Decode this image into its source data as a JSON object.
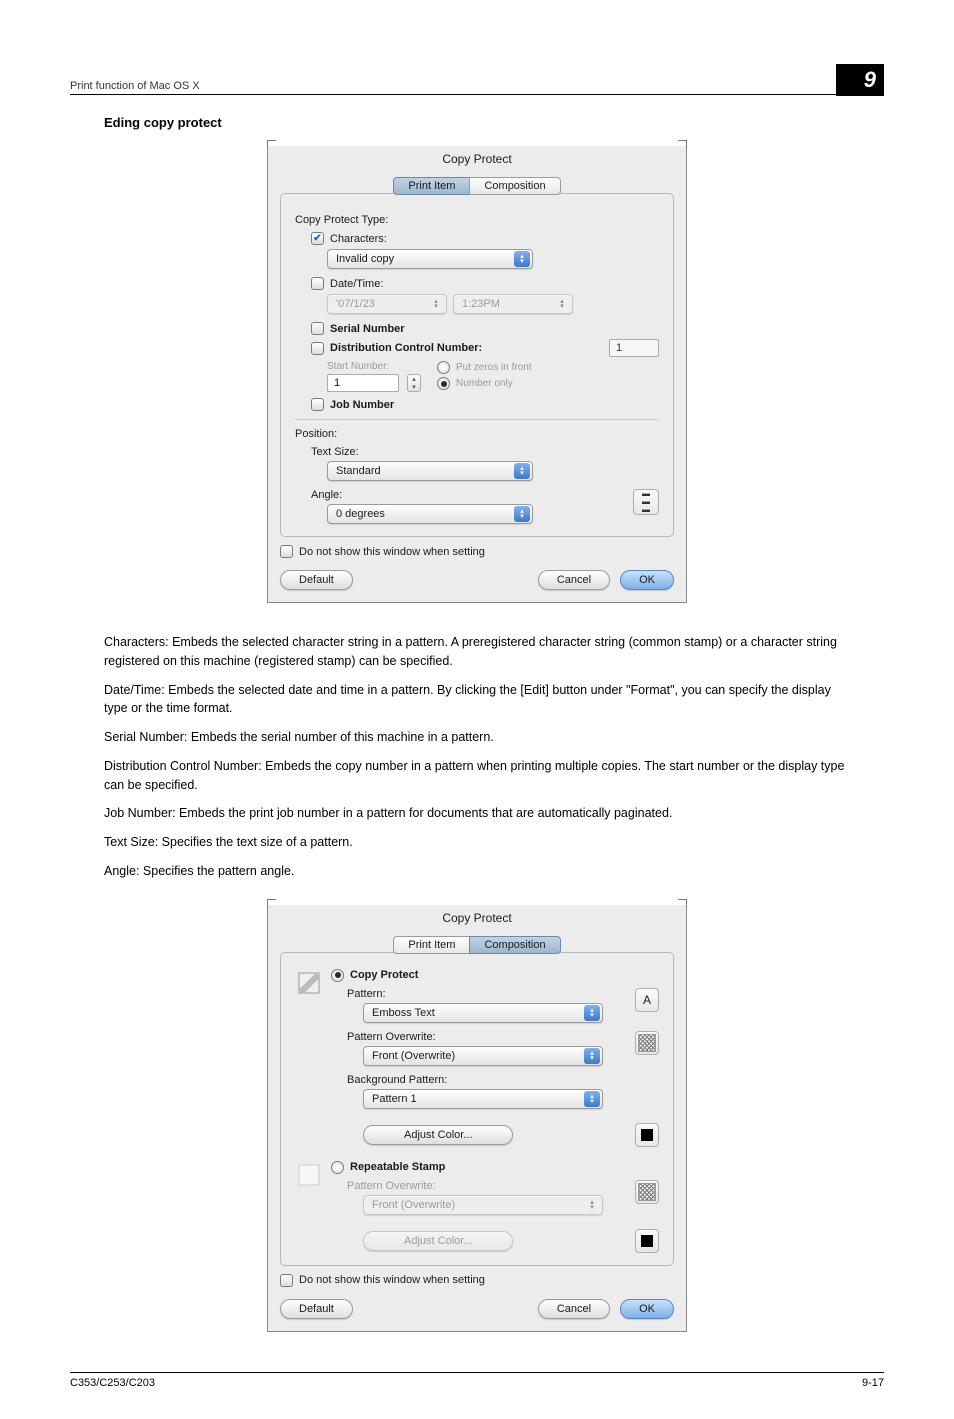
{
  "header": {
    "breadcrumb": "Print function of Mac OS X",
    "page_badge": "9"
  },
  "section_title": "Eding copy protect",
  "dlg1": {
    "title": "Copy Protect",
    "tabs": {
      "print_item": "Print Item",
      "composition": "Composition",
      "active": "print_item"
    },
    "copy_protect_type_label": "Copy Protect Type:",
    "characters": {
      "label": "Characters:",
      "checked": true,
      "select_value": "Invalid copy"
    },
    "datetime": {
      "label": "Date/Time:",
      "checked": false,
      "date_value": "'07/1/23",
      "time_value": "1:23PM"
    },
    "serial": {
      "label": "Serial Number",
      "checked": false
    },
    "dist": {
      "label": "Distribution Control Number:",
      "checked": false,
      "numbox_value": "1",
      "start_label": "Start Number:",
      "start_value": "1",
      "put_zeros": "Put zeros in front",
      "number_only": "Number only"
    },
    "job": {
      "label": "Job Number",
      "checked": false
    },
    "position_label": "Position:",
    "text_size": {
      "label": "Text Size:",
      "value": "Standard"
    },
    "angle": {
      "label": "Angle:",
      "value": "0 degrees"
    },
    "do_not_show": "Do not show this window when setting",
    "buttons": {
      "default": "Default",
      "cancel": "Cancel",
      "ok": "OK"
    }
  },
  "body": {
    "p1": "Characters: Embeds the selected character string in a pattern. A preregistered character string (common stamp) or a character string registered on this machine (registered stamp) can be specified.",
    "p2": "Date/Time: Embeds the selected date and time in a pattern. By clicking the [Edit] button under \"Format\", you can specify the display type or the time format.",
    "p3": "Serial Number: Embeds the serial number of this machine in a pattern.",
    "p4": "Distribution Control Number: Embeds the copy number in a pattern when printing multiple copies. The start number or the display type can be specified.",
    "p5": "Job Number: Embeds the print job number in a pattern for documents that are automatically paginated.",
    "p6": "Text Size: Specifies the text size of a pattern.",
    "p7": "Angle: Specifies the pattern angle."
  },
  "dlg2": {
    "title": "Copy Protect",
    "tabs": {
      "print_item": "Print Item",
      "composition": "Composition",
      "active": "composition"
    },
    "copy_protect_radio": "Copy Protect",
    "pattern": {
      "label": "Pattern:",
      "value": "Emboss Text"
    },
    "pattern_overwrite": {
      "label": "Pattern Overwrite:",
      "value": "Front (Overwrite)"
    },
    "bg_pattern": {
      "label": "Background Pattern:",
      "value": "Pattern 1"
    },
    "adjust_color": "Adjust Color...",
    "repeatable_radio": "Repeatable Stamp",
    "rep_pattern_overwrite": {
      "label": "Pattern Overwrite:",
      "value": "Front (Overwrite)"
    },
    "rep_adjust_color": "Adjust Color...",
    "do_not_show": "Do not show this window when setting",
    "buttons": {
      "default": "Default",
      "cancel": "Cancel",
      "ok": "OK"
    }
  },
  "footer": {
    "left": "C353/C253/C203",
    "right": "9-17"
  }
}
